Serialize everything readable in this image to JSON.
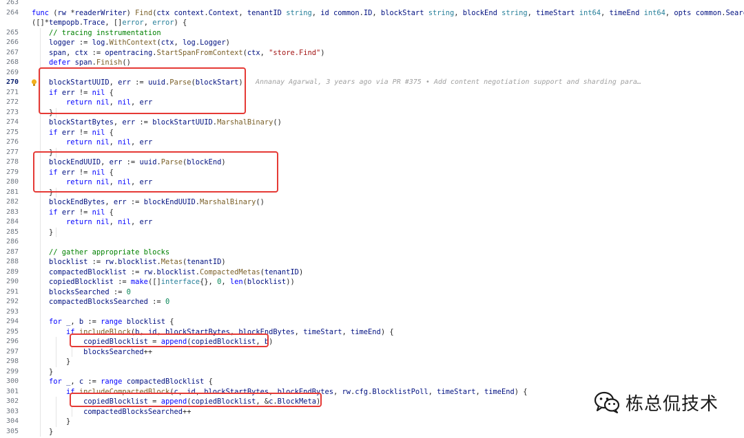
{
  "editor": {
    "current_line": 270,
    "blame_annotation": "Annanay Agarwal, 3 years ago via PR #375 • Add content negotiation support and sharding para…",
    "lines": [
      {
        "n": "263",
        "t": ""
      },
      {
        "n": "264",
        "t": "func (rw *readerWriter) Find(ctx context.Context, tenantID string, id common.ID, blockStart string, blockEnd string, timeStart int64, timeEnd int64, opts common.SearchOptions)"
      },
      {
        "n": "",
        "t": "([]*tempopb.Trace, []error, error) {"
      },
      {
        "n": "265",
        "t": "    // tracing instrumentation"
      },
      {
        "n": "266",
        "t": "    logger := log.WithContext(ctx, log.Logger)"
      },
      {
        "n": "267",
        "t": "    span, ctx := opentracing.StartSpanFromContext(ctx, \"store.Find\")"
      },
      {
        "n": "268",
        "t": "    defer span.Finish()"
      },
      {
        "n": "269",
        "t": ""
      },
      {
        "n": "270",
        "t": "    blockStartUUID, err := uuid.Parse(blockStart)"
      },
      {
        "n": "271",
        "t": "    if err != nil {"
      },
      {
        "n": "272",
        "t": "        return nil, nil, err"
      },
      {
        "n": "273",
        "t": "    }"
      },
      {
        "n": "274",
        "t": "    blockStartBytes, err := blockStartUUID.MarshalBinary()"
      },
      {
        "n": "275",
        "t": "    if err != nil {"
      },
      {
        "n": "276",
        "t": "        return nil, nil, err"
      },
      {
        "n": "277",
        "t": "    }"
      },
      {
        "n": "278",
        "t": "    blockEndUUID, err := uuid.Parse(blockEnd)"
      },
      {
        "n": "279",
        "t": "    if err != nil {"
      },
      {
        "n": "280",
        "t": "        return nil, nil, err"
      },
      {
        "n": "281",
        "t": "    }"
      },
      {
        "n": "282",
        "t": "    blockEndBytes, err := blockEndUUID.MarshalBinary()"
      },
      {
        "n": "283",
        "t": "    if err != nil {"
      },
      {
        "n": "284",
        "t": "        return nil, nil, err"
      },
      {
        "n": "285",
        "t": "    }"
      },
      {
        "n": "286",
        "t": ""
      },
      {
        "n": "287",
        "t": "    // gather appropriate blocks"
      },
      {
        "n": "288",
        "t": "    blocklist := rw.blocklist.Metas(tenantID)"
      },
      {
        "n": "289",
        "t": "    compactedBlocklist := rw.blocklist.CompactedMetas(tenantID)"
      },
      {
        "n": "290",
        "t": "    copiedBlocklist := make([]interface{}, 0, len(blocklist))"
      },
      {
        "n": "291",
        "t": "    blocksSearched := 0"
      },
      {
        "n": "292",
        "t": "    compactedBlocksSearched := 0"
      },
      {
        "n": "293",
        "t": ""
      },
      {
        "n": "294",
        "t": "    for _, b := range blocklist {"
      },
      {
        "n": "295",
        "t": "        if includeBlock(b, id, blockStartBytes, blockEndBytes, timeStart, timeEnd) {"
      },
      {
        "n": "296",
        "t": "            copiedBlocklist = append(copiedBlocklist, b)"
      },
      {
        "n": "297",
        "t": "            blocksSearched++"
      },
      {
        "n": "298",
        "t": "        }"
      },
      {
        "n": "299",
        "t": "    }"
      },
      {
        "n": "300",
        "t": "    for _, c := range compactedBlocklist {"
      },
      {
        "n": "301",
        "t": "        if includeCompactedBlock(c, id, blockStartBytes, blockEndBytes, rw.cfg.BlocklistPoll, timeStart, timeEnd) {"
      },
      {
        "n": "302",
        "t": "            copiedBlocklist = append(copiedBlocklist, &c.BlockMeta)"
      },
      {
        "n": "303",
        "t": "            compactedBlocksSearched++"
      },
      {
        "n": "304",
        "t": "        }"
      },
      {
        "n": "305",
        "t": "    }"
      }
    ]
  },
  "watermark": {
    "text": "栋总侃技术",
    "icon": "wechat-icon"
  },
  "colors": {
    "highlight_box": "#e53935",
    "keyword": "#0000ff",
    "type": "#267f99",
    "function": "#795e26",
    "string": "#a31515",
    "number": "#098658",
    "comment": "#008000"
  }
}
